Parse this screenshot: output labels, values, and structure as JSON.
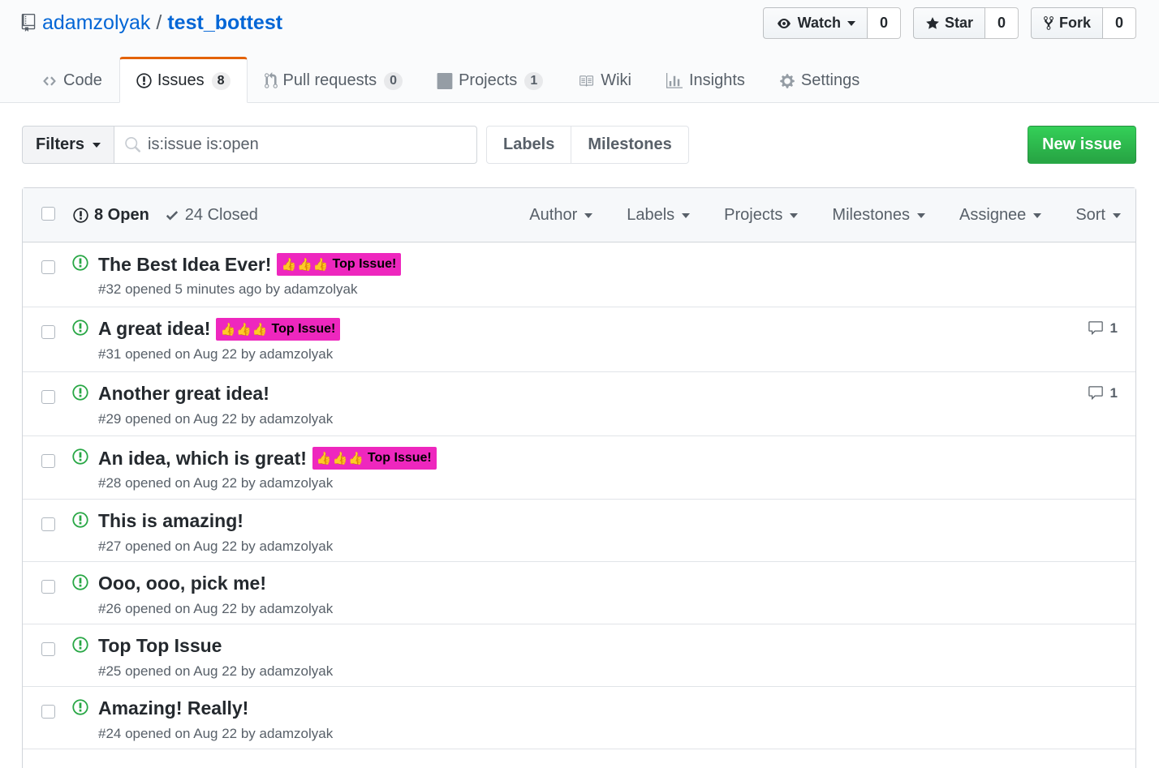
{
  "repo": {
    "owner": "adamzolyak",
    "separator": "/",
    "name": "test_bottest"
  },
  "actions": {
    "watch": {
      "label": "Watch",
      "count": "0"
    },
    "star": {
      "label": "Star",
      "count": "0"
    },
    "fork": {
      "label": "Fork",
      "count": "0"
    }
  },
  "nav": [
    {
      "label": "Code",
      "icon": "code-icon"
    },
    {
      "label": "Issues",
      "count": "8",
      "icon": "issue-opened-icon",
      "selected": true
    },
    {
      "label": "Pull requests",
      "count": "0",
      "icon": "git-pull-request-icon"
    },
    {
      "label": "Projects",
      "count": "1",
      "icon": "project-icon"
    },
    {
      "label": "Wiki",
      "icon": "book-icon"
    },
    {
      "label": "Insights",
      "icon": "graph-icon"
    },
    {
      "label": "Settings",
      "icon": "gear-icon"
    }
  ],
  "subnav": {
    "filters_label": "Filters",
    "search_value": "is:issue is:open",
    "labels_label": "Labels",
    "milestones_label": "Milestones",
    "new_issue_label": "New issue"
  },
  "issues_header": {
    "open_label": "8 Open",
    "closed_label": "24 Closed",
    "menus": [
      "Author",
      "Labels",
      "Projects",
      "Milestones",
      "Assignee",
      "Sort"
    ]
  },
  "label_text": "Top Issue!",
  "label_thumbs": "👍👍👍",
  "colors": {
    "label_bg": "#ee27be",
    "open_icon": "#28a745",
    "new_issue_bg": "#28a745",
    "selected_tab_accent": "#e36209"
  },
  "issues": [
    {
      "title": "The Best Idea Ever!",
      "meta": "#32 opened 5 minutes ago by adamzolyak",
      "label": true,
      "comments": ""
    },
    {
      "title": "A great idea!",
      "meta": "#31 opened on Aug 22 by adamzolyak",
      "label": true,
      "comments": "1"
    },
    {
      "title": "Another great idea!",
      "meta": "#29 opened on Aug 22 by adamzolyak",
      "label": false,
      "comments": "1"
    },
    {
      "title": "An idea, which is great!",
      "meta": "#28 opened on Aug 22 by adamzolyak",
      "label": true,
      "comments": ""
    },
    {
      "title": "This is amazing!",
      "meta": "#27 opened on Aug 22 by adamzolyak",
      "label": false,
      "comments": ""
    },
    {
      "title": "Ooo, ooo, pick me!",
      "meta": "#26 opened on Aug 22 by adamzolyak",
      "label": false,
      "comments": ""
    },
    {
      "title": "Top Top Issue",
      "meta": "#25 opened on Aug 22 by adamzolyak",
      "label": false,
      "comments": ""
    },
    {
      "title": "Amazing! Really!",
      "meta": "#24 opened on Aug 22 by adamzolyak",
      "label": false,
      "comments": ""
    }
  ]
}
